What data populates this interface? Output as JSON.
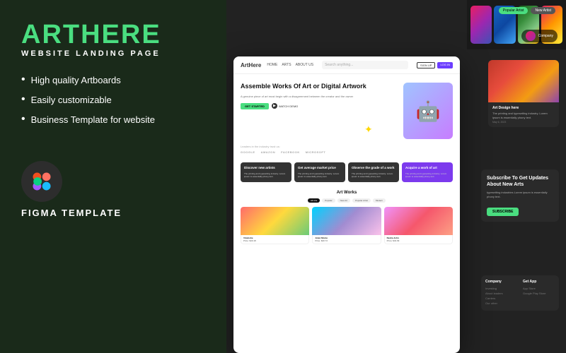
{
  "brand": {
    "name": "ARTHERE",
    "subtitle": "WEBSITE LANDING PAGE"
  },
  "features": [
    "High quality Artboards",
    "Easily customizable",
    "Business Template for website"
  ],
  "figma": {
    "label": "FIGMA TEMPLATE"
  },
  "mockup": {
    "nav": {
      "logo": "ArtHere",
      "links": [
        "HOME",
        "ARTS",
        "ABOUT US"
      ],
      "search_placeholder": "Search anything...",
      "btn_cart": "🛒",
      "btn_signup": "SIGN UP",
      "btn_login": "LOG IN"
    },
    "hero": {
      "title": "Assemble Works Of Art or Digital Artwork",
      "description": "A genuine piece of art must begin with a disagreement between the creator and the owner",
      "btn_start": "GET STARTED",
      "btn_demo": "WATCH DEMO",
      "trusted_label": "Leaders in the industry trust us:",
      "trusted_logos": [
        "GOOGLE",
        "AMAZON",
        "FACEBOOK",
        "MICROSOFT"
      ]
    },
    "cards": [
      {
        "title": "Discover new artists",
        "text": "The printing and typesetting industry. Lorem ipsum is essentially phony text."
      },
      {
        "title": "Get average market price",
        "text": "The printing and typesetting industry. Lorem ipsum is essentially phony text."
      },
      {
        "title": "Observe the grade of a work",
        "text": "The printing and typesetting industry. Lorem ipsum is essentially phony text."
      },
      {
        "title": "Acquire a work of art",
        "text": "The printing and typesetting industry. Lorem ipsum is essentially phony text.",
        "highlighted": true
      }
    ],
    "artworks": {
      "section_title": "Art Works",
      "tags": [
        "All Arts",
        "Popular",
        "New Art",
        "Popular Artist",
        "Modern"
      ],
      "active_tag": "All Arts",
      "items": [
        {
          "artist": "Vdumshe",
          "price": "$40.18"
        },
        {
          "artist": "Juten Monte",
          "price": "$40.72"
        },
        {
          "artist": "Nesha John",
          "price": "$43.09"
        }
      ]
    }
  },
  "right_panel": {
    "badges": [
      "Popular Artist",
      "New Artist"
    ],
    "art_card": {
      "title": "Art Design here",
      "text": "The printing and typesetting industry. Lorem ipsum is essentially phony text.",
      "date": "May 6, 2023"
    },
    "subscribe": {
      "title": "Subscribe To Get Updates About New Arts",
      "text": "typesetting industries Lorem ipsum is essentially phony text.",
      "btn": "SUBSCRIBE"
    },
    "footer_cols": [
      {
        "title": "Company",
        "links": [
          "Investing",
          "About leaders",
          "Carriers",
          "Our other"
        ]
      },
      {
        "title": "Get App",
        "links": [
          "App Store",
          "Google Play Store"
        ]
      }
    ]
  }
}
